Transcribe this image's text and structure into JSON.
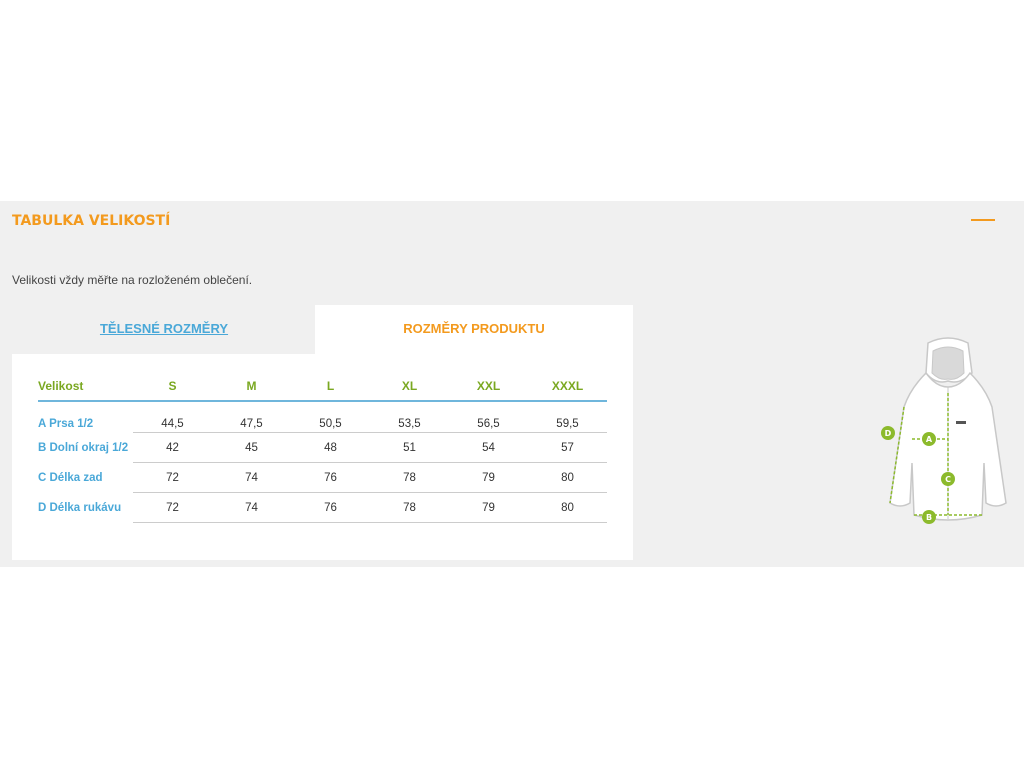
{
  "panel": {
    "title": "TABULKA VELIKOSTÍ",
    "note": "Velikosti vždy měřte na rozloženém oblečení."
  },
  "tabs": {
    "body": "TĚLESNÉ ROZMĚRY",
    "product": "ROZMĚRY PRODUKTU"
  },
  "table": {
    "header": [
      "Velikost",
      "S",
      "M",
      "L",
      "XL",
      "XXL",
      "XXXL"
    ],
    "rows": [
      {
        "label": "A Prsa 1/2",
        "values": [
          "44,5",
          "47,5",
          "50,5",
          "53,5",
          "56,5",
          "59,5"
        ]
      },
      {
        "label": "B Dolní okraj 1/2",
        "values": [
          "42",
          "45",
          "48",
          "51",
          "54",
          "57"
        ]
      },
      {
        "label": "C Délka zad",
        "values": [
          "72",
          "74",
          "76",
          "78",
          "79",
          "80"
        ]
      },
      {
        "label": "D Délka rukávu",
        "values": [
          "72",
          "74",
          "76",
          "78",
          "79",
          "80"
        ]
      }
    ]
  },
  "diagram": {
    "markers": [
      "A",
      "B",
      "C",
      "D"
    ],
    "accent": "#8cba2c"
  },
  "colors": {
    "accent_orange": "#f39a1e",
    "link_blue": "#4aa8d8",
    "header_green": "#7aa821"
  }
}
